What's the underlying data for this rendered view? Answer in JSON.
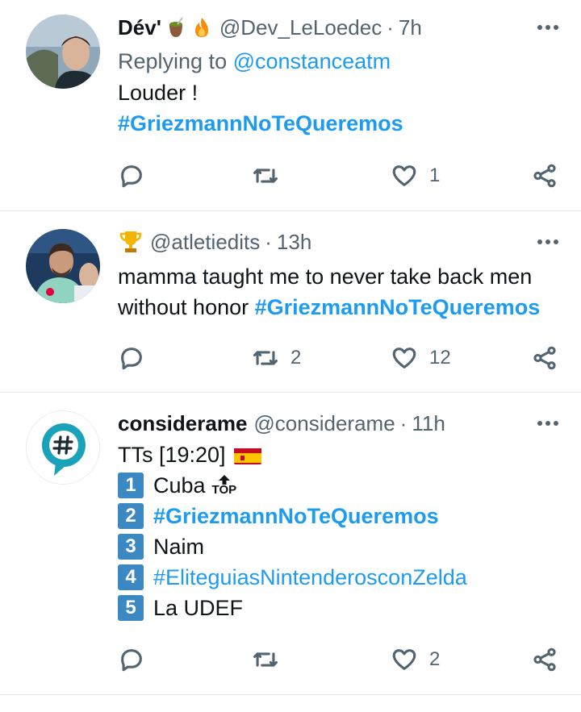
{
  "tweets": [
    {
      "name": "Dév'",
      "handle": "@Dev_LeLoedec",
      "time": "7h",
      "reply_prefix": "Replying to",
      "reply_to": "@constanceatm",
      "text_line1": "Louder !",
      "hashtag": "#GriezmannNoTeQueremos",
      "likes": "1",
      "name_icons": [
        "mate-cup-icon",
        "fire-icon"
      ]
    },
    {
      "name_icon": "trophy-icon",
      "handle": "@atletiedits",
      "time": "13h",
      "text_line1": "mamma taught me to never take back men",
      "text_line2_prefix": "without honor",
      "hashtag": "#GriezmannNoTeQueremos",
      "retweets": "2",
      "likes": "12"
    },
    {
      "name": "considerame",
      "handle": "@considerame",
      "time": "11h",
      "tt_header": "TTs [19:20]",
      "flag_icon": "spain-flag-icon",
      "top_label": "TOP",
      "trends": [
        {
          "rank": "1",
          "label": "Cuba",
          "hashtag": false
        },
        {
          "rank": "2",
          "label": "#GriezmannNoTeQueremos",
          "hashtag": true
        },
        {
          "rank": "3",
          "label": "Naim",
          "hashtag": false
        },
        {
          "rank": "4",
          "label": "#EliteguiasNintenderosconZelda",
          "hashtag": true
        },
        {
          "rank": "5",
          "label": "La UDEF",
          "hashtag": false
        }
      ],
      "likes": "2"
    }
  ],
  "colors": {
    "link": "#1d9bf0",
    "secondary_text": "#536471",
    "divider": "#e6ecf0",
    "keycap": "#3b88c3",
    "considerame_brand": "#1aa3b8"
  },
  "separator": "·"
}
